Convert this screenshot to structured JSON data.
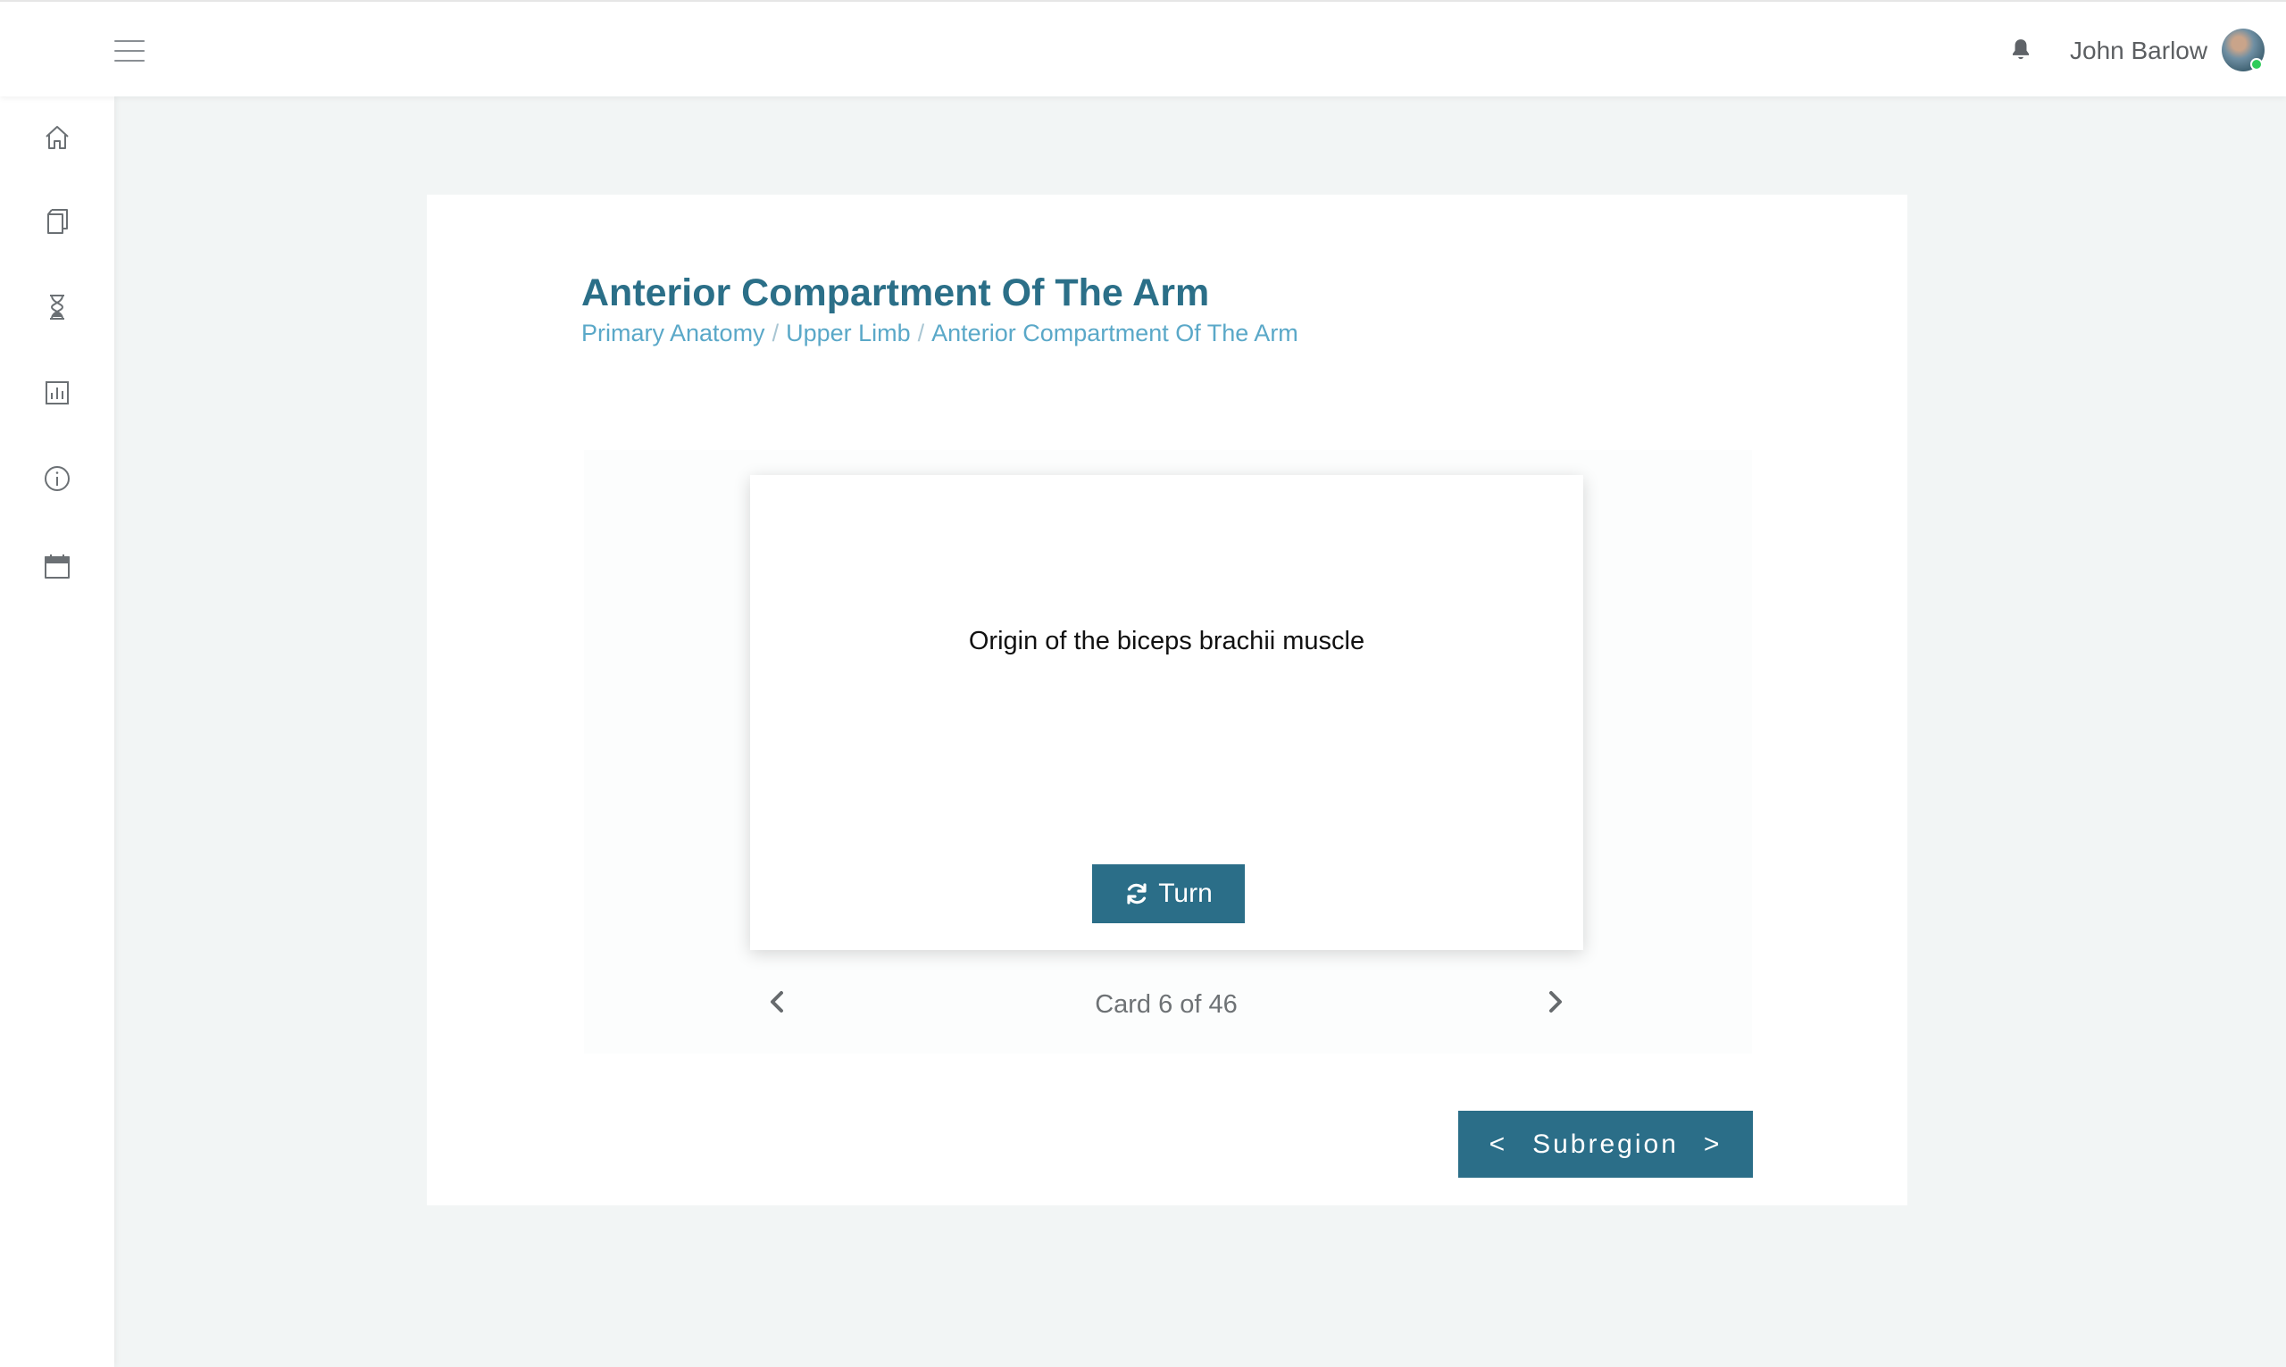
{
  "header": {
    "user_name": "John Barlow",
    "icons": [
      "menu-icon",
      "bell-icon",
      "avatar"
    ],
    "status_color": "#2ecc5a"
  },
  "sidebar": {
    "items": [
      {
        "icon": "home-icon"
      },
      {
        "icon": "book-icon"
      },
      {
        "icon": "hourglass-icon"
      },
      {
        "icon": "bar-chart-icon"
      },
      {
        "icon": "info-icon"
      },
      {
        "icon": "calendar-icon"
      }
    ]
  },
  "page": {
    "title": "Anterior Compartment Of The Arm",
    "breadcrumb": [
      "Primary Anatomy",
      "Upper Limb",
      "Anterior Compartment Of The Arm"
    ],
    "separator": "/"
  },
  "flashcard": {
    "text": "Origin of the biceps brachii muscle",
    "turn_label": "Turn",
    "counter": "Card 6 of 46",
    "current": 6,
    "total": 46
  },
  "subregion": {
    "prev_symbol": "<",
    "label": "Subregion",
    "next_symbol": ">"
  },
  "colors": {
    "accent": "#2b6e88",
    "title": "#2b6f88",
    "breadcrumb": "#5aa8c8",
    "background": "#f2f5f5"
  }
}
